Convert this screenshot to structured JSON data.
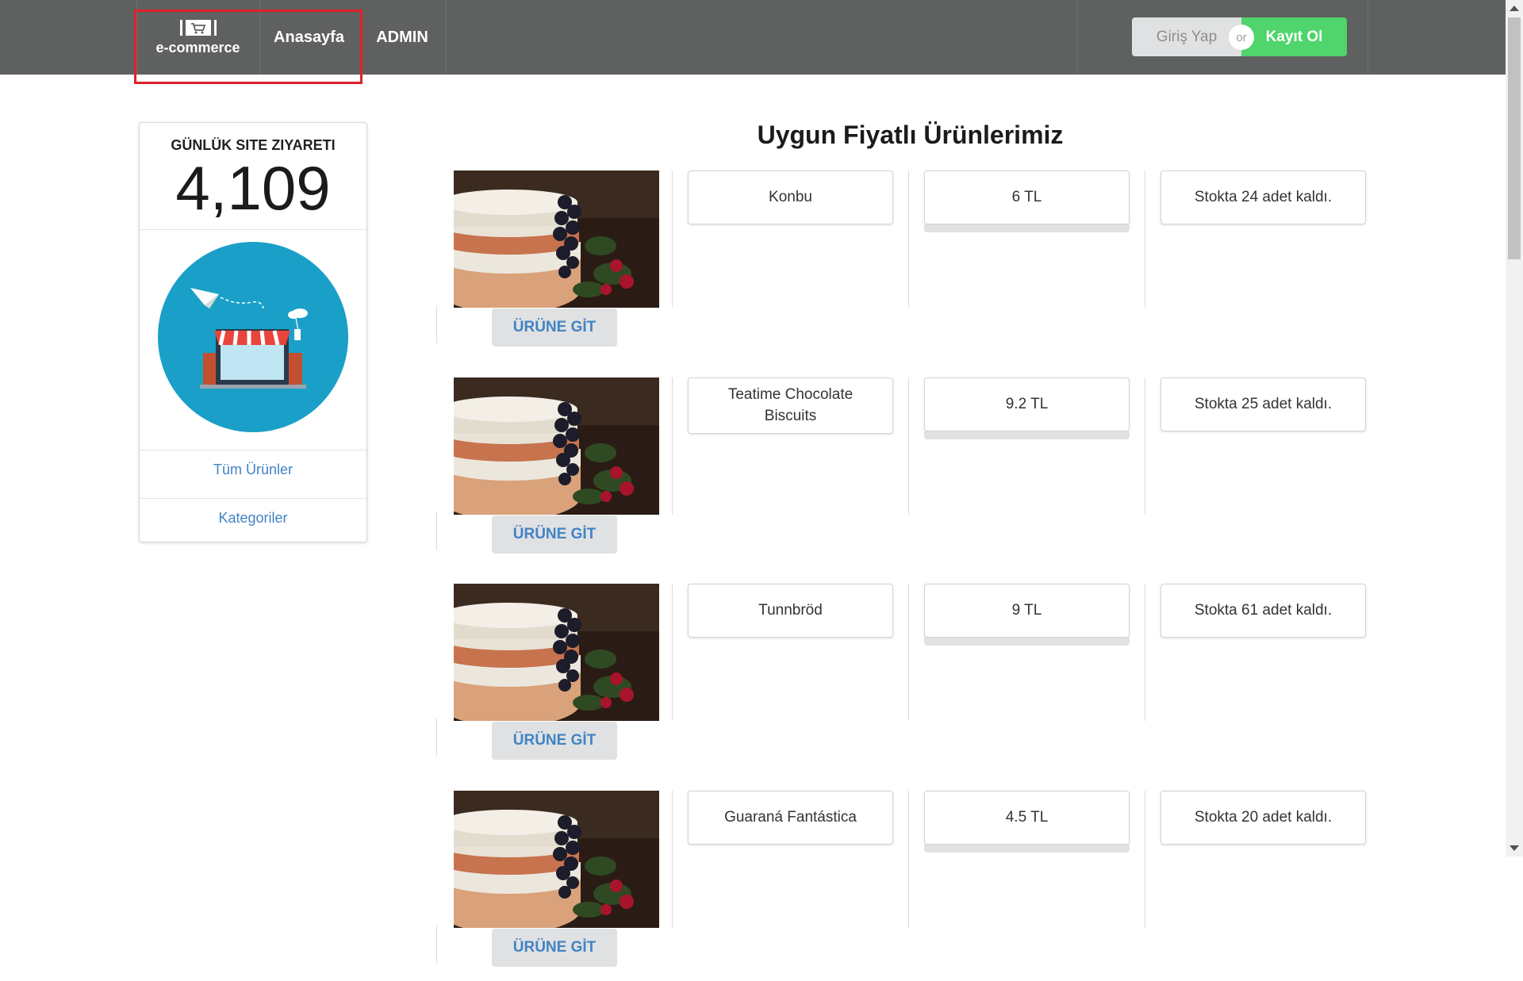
{
  "nav": {
    "brand": "e-commerce",
    "home": "Anasayfa",
    "admin": "ADMIN",
    "login": "Giriş Yap",
    "or": "or",
    "register": "Kayıt Ol"
  },
  "sidebar": {
    "visits_label": "GÜNLÜK SITE ZIYARETI",
    "visits_value": "4,109",
    "links": [
      "Tüm Ürünler",
      "Kategoriler"
    ]
  },
  "main": {
    "title": "Uygun Fiyatlı Ürünlerimiz",
    "go_button": "ÜRÜNE GİT",
    "products": [
      {
        "name": "Konbu",
        "price": "6 TL",
        "stock": "Stokta 24 adet kaldı."
      },
      {
        "name": "Teatime Chocolate Biscuits",
        "price": "9.2 TL",
        "stock": "Stokta 25 adet kaldı."
      },
      {
        "name": "Tunnbröd",
        "price": "9 TL",
        "stock": "Stokta 61 adet kaldı."
      },
      {
        "name": "Guaraná Fantástica",
        "price": "4.5 TL",
        "stock": "Stokta 20 adet kaldı."
      }
    ]
  },
  "colors": {
    "navbar": "#5f6060",
    "register": "#4fd56b",
    "link": "#4183c4",
    "highlight": "#e0202a",
    "illustration_bg": "#1aa0c8"
  },
  "icons": [
    "cart-icon",
    "store-illustration",
    "paper-plane-icon",
    "cloud-icon",
    "product-image"
  ]
}
